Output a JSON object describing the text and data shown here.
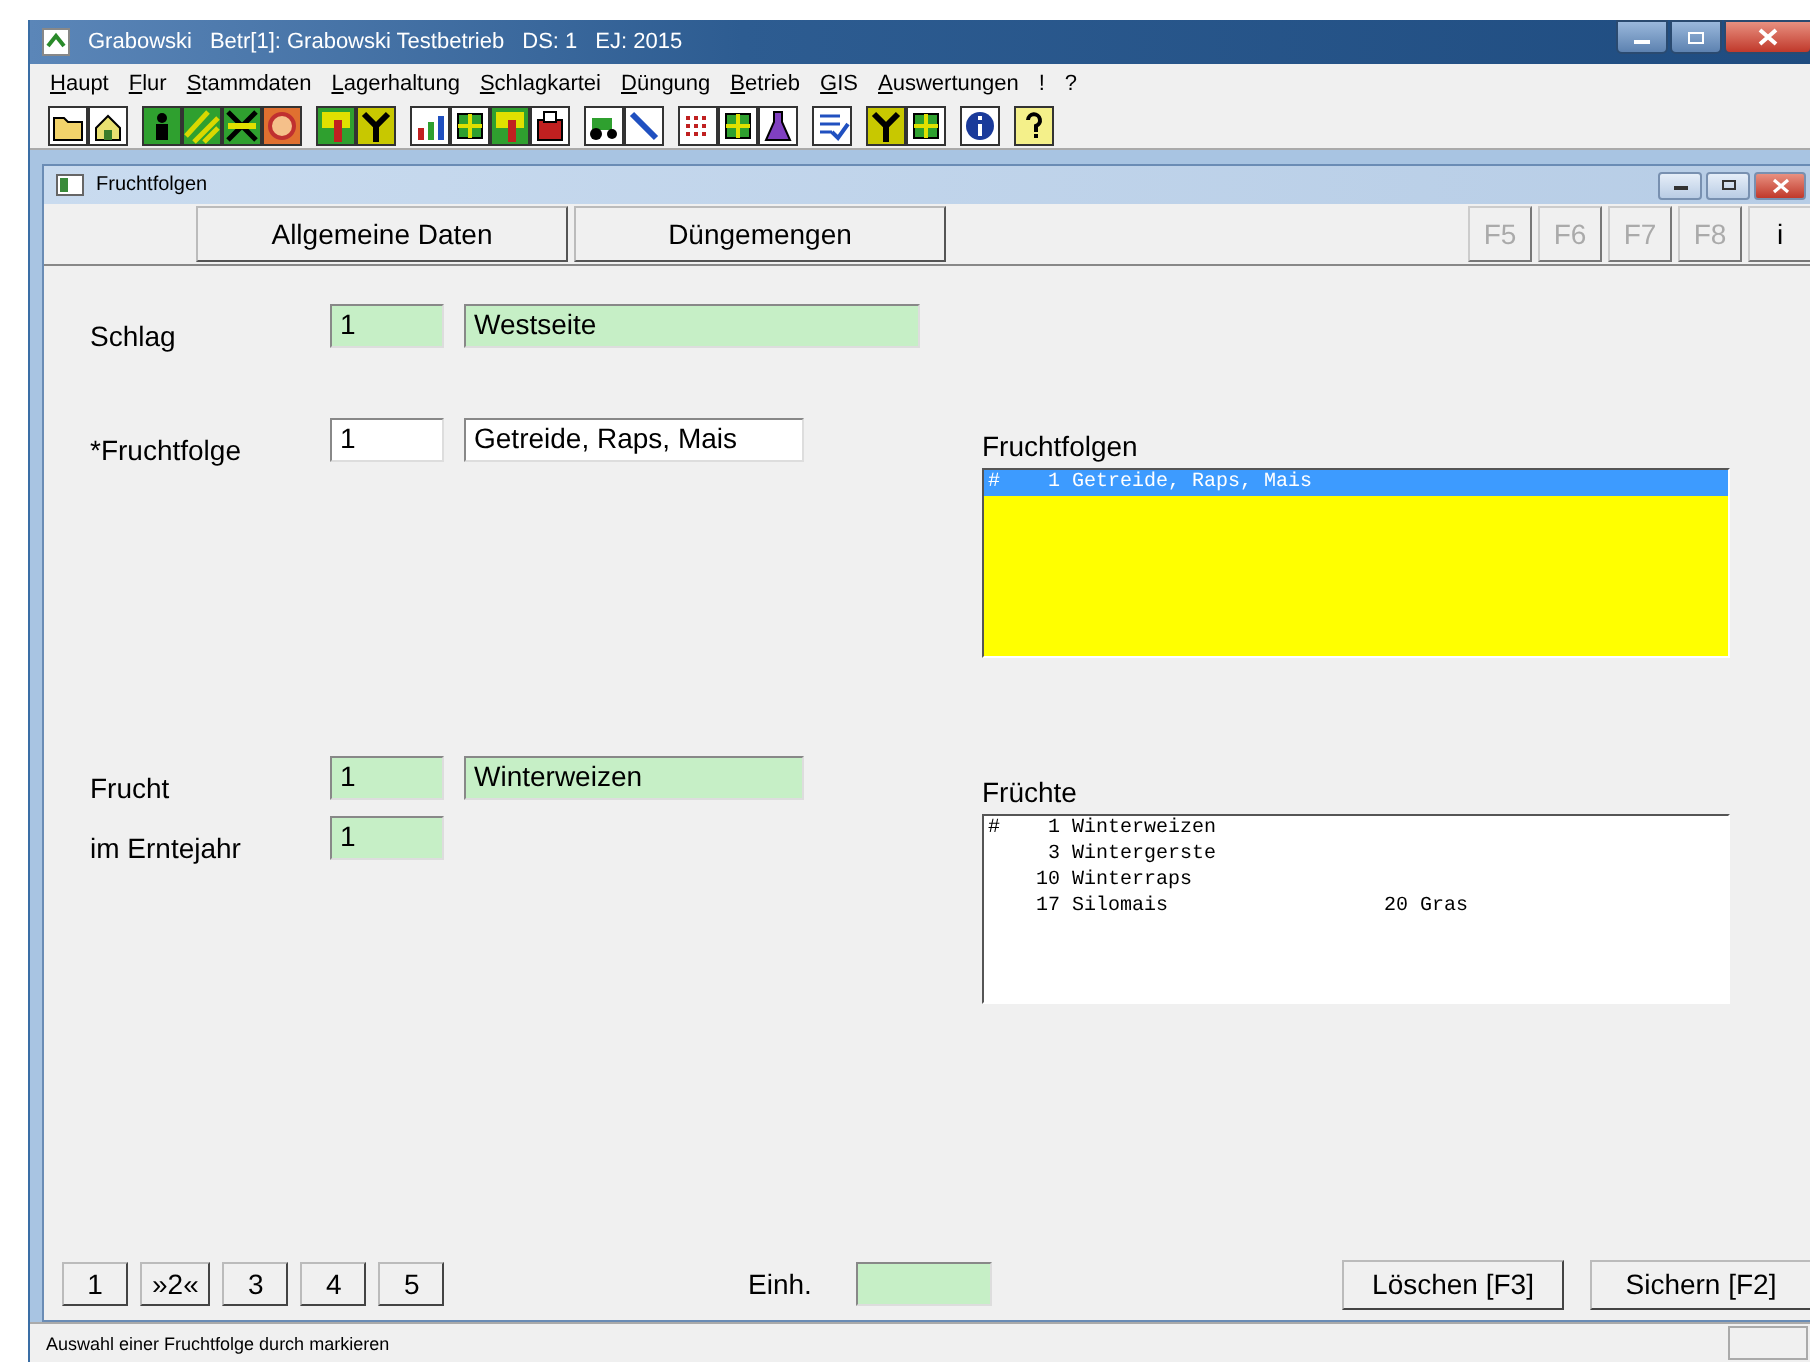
{
  "window": {
    "title_parts": [
      "Grabowski",
      "Betr[1]: Grabowski Testbetrieb",
      "DS: 1",
      "EJ: 2015"
    ]
  },
  "menu": [
    "Haupt",
    "Flur",
    "Stammdaten",
    "Lagerhaltung",
    "Schlagkartei",
    "Düngung",
    "Betrieb",
    "GIS",
    "Auswertungen",
    "!",
    "?"
  ],
  "child_window": {
    "title": "Fruchtfolgen"
  },
  "tabs": [
    {
      "label": "Allgemeine Daten",
      "disabled": false
    },
    {
      "label": "Düngemengen",
      "disabled": false
    }
  ],
  "function_keys": [
    {
      "label": "F5",
      "disabled": true
    },
    {
      "label": "F6",
      "disabled": true
    },
    {
      "label": "F7",
      "disabled": true
    },
    {
      "label": "F8",
      "disabled": true
    },
    {
      "label": "i",
      "disabled": false
    }
  ],
  "form_rows": [
    {
      "label": "Schlag",
      "fields": [
        {
          "value": "1",
          "readonly": true
        },
        {
          "value": "Westseite",
          "readonly": true
        }
      ]
    },
    {
      "label": "*Fruchtfolge",
      "fields": [
        {
          "value": "1",
          "readonly": false
        },
        {
          "value": "Getreide, Raps, Mais",
          "readonly": false
        }
      ]
    },
    {
      "label": "Frucht",
      "fields": [
        {
          "value": "1",
          "readonly": true
        },
        {
          "value": "Winterweizen",
          "readonly": true
        }
      ]
    },
    {
      "label": "im Erntejahr",
      "fields": [
        {
          "value": "1",
          "readonly": true
        }
      ]
    }
  ],
  "lists": [
    {
      "title": "Fruchtfolgen",
      "highlight": true,
      "rows": [
        {
          "marker": "#",
          "entries": [
            {
              "number": "1",
              "name": "Getreide, Raps, Mais"
            }
          ],
          "selected": true
        }
      ]
    },
    {
      "title": "Früchte",
      "highlight": false,
      "rows": [
        {
          "marker": "#",
          "entries": [
            {
              "number": "1",
              "name": "Winterweizen"
            }
          ],
          "selected": false
        },
        {
          "entries": [
            {
              "number": "3",
              "name": "Wintergerste"
            }
          ],
          "selected": false
        },
        {
          "entries": [
            {
              "number": "10",
              "name": "Winterraps"
            }
          ],
          "selected": false
        },
        {
          "entries": [
            {
              "number": "17",
              "name": "Silomais"
            },
            {
              "number": "20",
              "name": "Gras"
            }
          ],
          "selected": false
        }
      ]
    }
  ],
  "pages": [
    "1",
    "»2«",
    "3",
    "4",
    "5"
  ],
  "unit": {
    "label": "Einh."
  },
  "actions": [
    "Löschen [F3]",
    "Sichern [F2]"
  ],
  "status_bar": {
    "text": "Auswahl einer Fruchtfolge durch markieren"
  }
}
